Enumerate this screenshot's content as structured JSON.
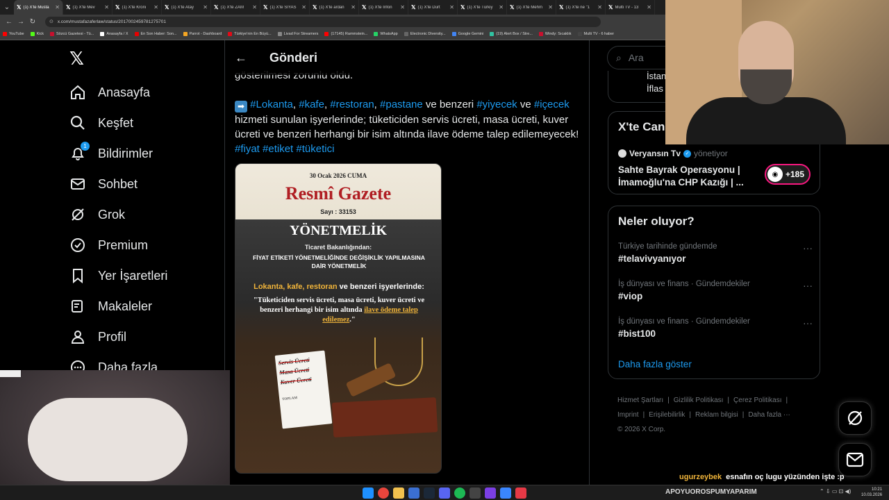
{
  "browser": {
    "tabs": [
      {
        "title": "(1) X'te Musta"
      },
      {
        "title": "(1) X'te Mev"
      },
      {
        "title": "(1) X'te Kroni"
      },
      {
        "title": "(1) X'te Atay"
      },
      {
        "title": "(1) X'te ZAM"
      },
      {
        "title": "(1) X'te SİYAS"
      },
      {
        "title": "(1) X'te ardan"
      },
      {
        "title": "(1) X'te Infon"
      },
      {
        "title": "(1) X'te Dürt"
      },
      {
        "title": "(1) X'te Türkiy"
      },
      {
        "title": "(1) X'te Mehm"
      },
      {
        "title": "(1) X'te ne \"1"
      },
      {
        "title": "Multi TV - 13"
      }
    ],
    "url": "x.com/mustafazaferlaw/status/2017002459781275701",
    "bookmarks": [
      {
        "label": "YouTube",
        "color": "#ff0000"
      },
      {
        "label": "Kick",
        "color": "#53fc18"
      },
      {
        "label": "Sözcü Gazetesi - Tü...",
        "color": "#c8102e"
      },
      {
        "label": "Anasayfa / X",
        "color": "#ffffff"
      },
      {
        "label": "En Son Haber: Son...",
        "color": "#e60000"
      },
      {
        "label": "Parrot - Dashboard",
        "color": "#f5a623"
      },
      {
        "label": "Türkiye'nin En Büyü...",
        "color": "#e30a17"
      },
      {
        "label": "Livad For Streamers",
        "color": "#888888"
      },
      {
        "label": "(17145) Rammstein...",
        "color": "#ff0000"
      },
      {
        "label": "WhatsApp",
        "color": "#25d366"
      },
      {
        "label": "Electronic Diversity...",
        "color": "#666666"
      },
      {
        "label": "Google Gemini",
        "color": "#4285f4"
      },
      {
        "label": "(19) Alert Box / Stre...",
        "color": "#31c3a2"
      },
      {
        "label": "Windy: Sıcaklık",
        "color": "#c8102e"
      },
      {
        "label": "Multi TV - 6 haber",
        "color": "#444444"
      }
    ]
  },
  "nav": {
    "items": [
      {
        "label": "Anasayfa",
        "icon": "home-icon"
      },
      {
        "label": "Keşfet",
        "icon": "search-icon"
      },
      {
        "label": "Bildirimler",
        "icon": "bell-icon",
        "badge": "1"
      },
      {
        "label": "Sohbet",
        "icon": "mail-icon"
      },
      {
        "label": "Grok",
        "icon": "grok-icon"
      },
      {
        "label": "Premium",
        "icon": "premium-icon"
      },
      {
        "label": "Yer İşaretleri",
        "icon": "bookmark-icon"
      },
      {
        "label": "Makaleler",
        "icon": "article-icon"
      },
      {
        "label": "Profil",
        "icon": "profile-icon"
      },
      {
        "label": "Daha fazla",
        "icon": "more-icon"
      }
    ]
  },
  "post": {
    "header": "Gönderi",
    "prev_line": "gösterilmesi zorunlu oldu.",
    "tag_lokanta": "#Lokanta",
    "tag_kafe": "#kafe",
    "tag_restoran": "#restoran",
    "tag_pastane": "#pastane",
    "text_benzeri": "ve benzeri",
    "tag_yiyecek": "#yiyecek",
    "text_ve": "ve",
    "tag_icecek": "#içecek",
    "text_body": "hizmeti sunulan işyerlerinde; tüketiciden servis ücreti, masa ücreti, kuver ücreti ve benzeri herhangi bir isim altında ilave ödeme talep edilemeyecek!",
    "tag_fiyat": "#fiyat",
    "tag_etiket": "#etiket",
    "tag_tuketici": "#tüketici"
  },
  "gazette": {
    "date": "30 Ocak 2026 CUMA",
    "title": "Resmî Gazete",
    "issue": "Sayı : 33153",
    "regulation": "YÖNETMELİK",
    "ministry": "Ticaret Bakanlığından:",
    "subject": "FİYAT ETİKETİ YÖNETMELİĞİNDE DEĞİŞİKLİK YAPILMASINA DAİR YÖNETMELİK",
    "venues": "Lokanta, kafe, restoran",
    "venues_rest": "ve benzeri işyerlerinde:",
    "quote": "\"Tüketiciden servis ücreti, masa ücreti, kuver ücreti ve benzeri herhangi bir isim altında",
    "quote_highlight": "ilave ödeme talep edilemez",
    "quote_end": ".\"",
    "receipt": [
      "Servis Ücreti",
      "Masa Ücreti",
      "Kuver Ücreti"
    ],
    "receipt_total": "TOPLAM"
  },
  "sidebar": {
    "search_placeholder": "Ara",
    "partial_top": "İstan",
    "partial_bottom": "İflas",
    "live_heading": "X'te Can",
    "live_user": "Veryansın Tv",
    "live_role": "yönetiyor",
    "live_title": "Sahte Bayrak Operasyonu | İmamoğlu'na CHP Kazığı | ...",
    "live_count": "+185",
    "trends_heading": "Neler oluyor?",
    "trends": [
      {
        "meta": "Türkiye tarihinde gündemde",
        "name": "#telavivyanıyor"
      },
      {
        "meta": "İş dünyası ve finans · Gündemdekiler",
        "name": "#viop"
      },
      {
        "meta": "İş dünyası ve finans · Gündemdekiler",
        "name": "#bist100"
      }
    ],
    "show_more": "Daha fazla göster",
    "footer": [
      "Hizmet Şartları",
      "|",
      "Gizlilik Politikası",
      "|",
      "Çerez Politikası",
      "|",
      "Imprint",
      "|",
      "Erişilebilirlik",
      "|",
      "Reklam bilgisi",
      "|",
      "Daha fazla ···",
      "© 2026 X Corp."
    ]
  },
  "stream": {
    "chat_user": "ugurzeybek",
    "chat_message": "esnafın oç lugu yüzünden işte :p",
    "banner": "APOYUOROSPUMYAPARIM"
  },
  "taskbar": {
    "time": "10:21",
    "date": "10.03.2026"
  },
  "colors": {
    "accent": "#1d9bf0",
    "background": "#000000",
    "pink": "#f91880"
  }
}
